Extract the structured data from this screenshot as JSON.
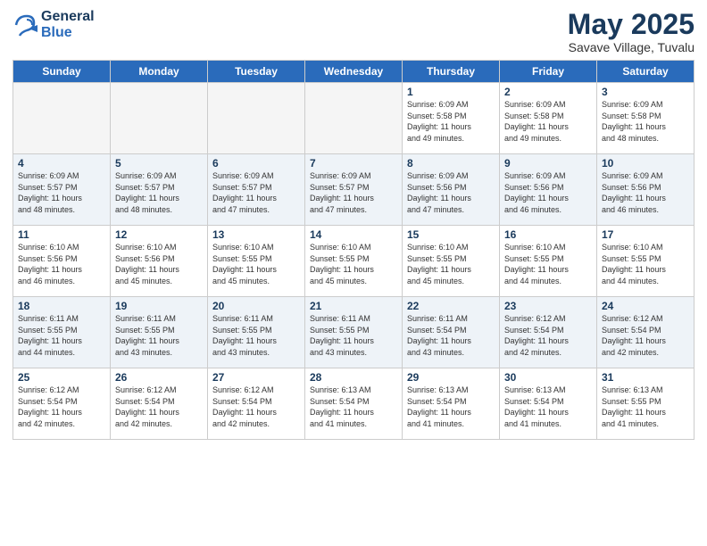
{
  "header": {
    "logo_line1": "General",
    "logo_line2": "Blue",
    "main_title": "May 2025",
    "subtitle": "Savave Village, Tuvalu"
  },
  "days_of_week": [
    "Sunday",
    "Monday",
    "Tuesday",
    "Wednesday",
    "Thursday",
    "Friday",
    "Saturday"
  ],
  "weeks": [
    [
      {
        "num": "",
        "detail": ""
      },
      {
        "num": "",
        "detail": ""
      },
      {
        "num": "",
        "detail": ""
      },
      {
        "num": "",
        "detail": ""
      },
      {
        "num": "1",
        "detail": "Sunrise: 6:09 AM\nSunset: 5:58 PM\nDaylight: 11 hours\nand 49 minutes."
      },
      {
        "num": "2",
        "detail": "Sunrise: 6:09 AM\nSunset: 5:58 PM\nDaylight: 11 hours\nand 49 minutes."
      },
      {
        "num": "3",
        "detail": "Sunrise: 6:09 AM\nSunset: 5:58 PM\nDaylight: 11 hours\nand 48 minutes."
      }
    ],
    [
      {
        "num": "4",
        "detail": "Sunrise: 6:09 AM\nSunset: 5:57 PM\nDaylight: 11 hours\nand 48 minutes."
      },
      {
        "num": "5",
        "detail": "Sunrise: 6:09 AM\nSunset: 5:57 PM\nDaylight: 11 hours\nand 48 minutes."
      },
      {
        "num": "6",
        "detail": "Sunrise: 6:09 AM\nSunset: 5:57 PM\nDaylight: 11 hours\nand 47 minutes."
      },
      {
        "num": "7",
        "detail": "Sunrise: 6:09 AM\nSunset: 5:57 PM\nDaylight: 11 hours\nand 47 minutes."
      },
      {
        "num": "8",
        "detail": "Sunrise: 6:09 AM\nSunset: 5:56 PM\nDaylight: 11 hours\nand 47 minutes."
      },
      {
        "num": "9",
        "detail": "Sunrise: 6:09 AM\nSunset: 5:56 PM\nDaylight: 11 hours\nand 46 minutes."
      },
      {
        "num": "10",
        "detail": "Sunrise: 6:09 AM\nSunset: 5:56 PM\nDaylight: 11 hours\nand 46 minutes."
      }
    ],
    [
      {
        "num": "11",
        "detail": "Sunrise: 6:10 AM\nSunset: 5:56 PM\nDaylight: 11 hours\nand 46 minutes."
      },
      {
        "num": "12",
        "detail": "Sunrise: 6:10 AM\nSunset: 5:56 PM\nDaylight: 11 hours\nand 45 minutes."
      },
      {
        "num": "13",
        "detail": "Sunrise: 6:10 AM\nSunset: 5:55 PM\nDaylight: 11 hours\nand 45 minutes."
      },
      {
        "num": "14",
        "detail": "Sunrise: 6:10 AM\nSunset: 5:55 PM\nDaylight: 11 hours\nand 45 minutes."
      },
      {
        "num": "15",
        "detail": "Sunrise: 6:10 AM\nSunset: 5:55 PM\nDaylight: 11 hours\nand 45 minutes."
      },
      {
        "num": "16",
        "detail": "Sunrise: 6:10 AM\nSunset: 5:55 PM\nDaylight: 11 hours\nand 44 minutes."
      },
      {
        "num": "17",
        "detail": "Sunrise: 6:10 AM\nSunset: 5:55 PM\nDaylight: 11 hours\nand 44 minutes."
      }
    ],
    [
      {
        "num": "18",
        "detail": "Sunrise: 6:11 AM\nSunset: 5:55 PM\nDaylight: 11 hours\nand 44 minutes."
      },
      {
        "num": "19",
        "detail": "Sunrise: 6:11 AM\nSunset: 5:55 PM\nDaylight: 11 hours\nand 43 minutes."
      },
      {
        "num": "20",
        "detail": "Sunrise: 6:11 AM\nSunset: 5:55 PM\nDaylight: 11 hours\nand 43 minutes."
      },
      {
        "num": "21",
        "detail": "Sunrise: 6:11 AM\nSunset: 5:55 PM\nDaylight: 11 hours\nand 43 minutes."
      },
      {
        "num": "22",
        "detail": "Sunrise: 6:11 AM\nSunset: 5:54 PM\nDaylight: 11 hours\nand 43 minutes."
      },
      {
        "num": "23",
        "detail": "Sunrise: 6:12 AM\nSunset: 5:54 PM\nDaylight: 11 hours\nand 42 minutes."
      },
      {
        "num": "24",
        "detail": "Sunrise: 6:12 AM\nSunset: 5:54 PM\nDaylight: 11 hours\nand 42 minutes."
      }
    ],
    [
      {
        "num": "25",
        "detail": "Sunrise: 6:12 AM\nSunset: 5:54 PM\nDaylight: 11 hours\nand 42 minutes."
      },
      {
        "num": "26",
        "detail": "Sunrise: 6:12 AM\nSunset: 5:54 PM\nDaylight: 11 hours\nand 42 minutes."
      },
      {
        "num": "27",
        "detail": "Sunrise: 6:12 AM\nSunset: 5:54 PM\nDaylight: 11 hours\nand 42 minutes."
      },
      {
        "num": "28",
        "detail": "Sunrise: 6:13 AM\nSunset: 5:54 PM\nDaylight: 11 hours\nand 41 minutes."
      },
      {
        "num": "29",
        "detail": "Sunrise: 6:13 AM\nSunset: 5:54 PM\nDaylight: 11 hours\nand 41 minutes."
      },
      {
        "num": "30",
        "detail": "Sunrise: 6:13 AM\nSunset: 5:54 PM\nDaylight: 11 hours\nand 41 minutes."
      },
      {
        "num": "31",
        "detail": "Sunrise: 6:13 AM\nSunset: 5:55 PM\nDaylight: 11 hours\nand 41 minutes."
      }
    ]
  ]
}
